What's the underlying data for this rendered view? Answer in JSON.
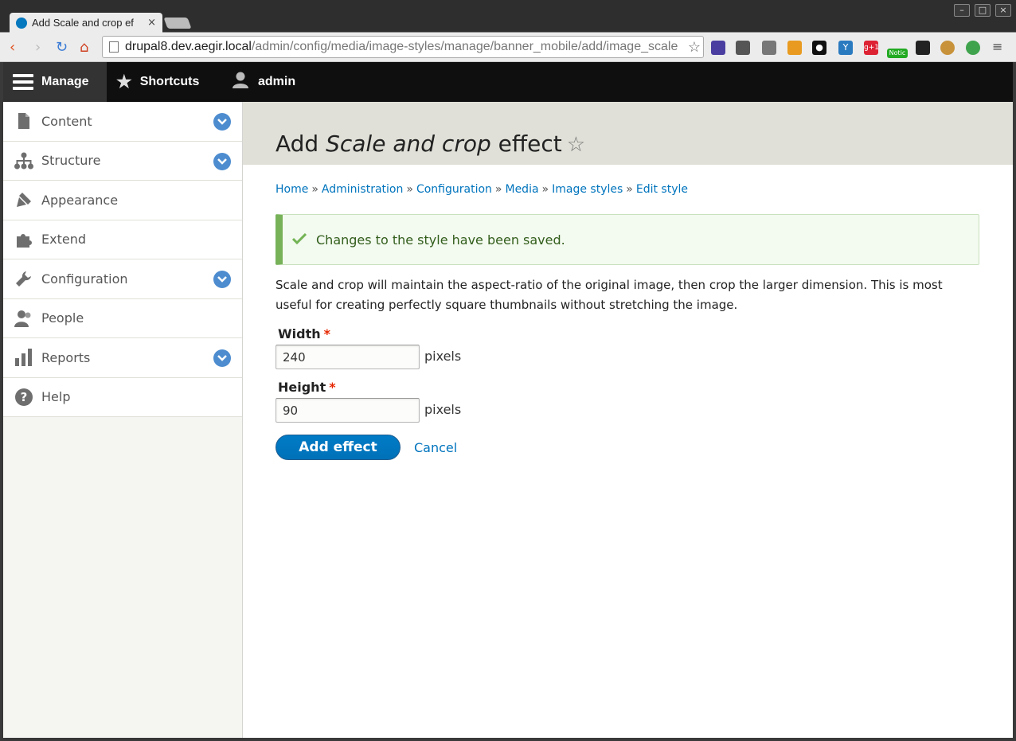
{
  "browser": {
    "tab_title": "Add Scale and crop ef",
    "url_host": "drupal8.dev.aegir.local",
    "url_path": "/admin/config/media/image-styles/manage/banner_mobile/add/image_scale",
    "badge_text": "Notic"
  },
  "toolbar": {
    "manage": "Manage",
    "shortcuts": "Shortcuts",
    "user": "admin"
  },
  "sidebar": {
    "items": [
      {
        "label": "Content",
        "icon": "file-icon",
        "expandable": true
      },
      {
        "label": "Structure",
        "icon": "sitemap-icon",
        "expandable": true
      },
      {
        "label": "Appearance",
        "icon": "paintbrush-icon",
        "expandable": false
      },
      {
        "label": "Extend",
        "icon": "puzzle-icon",
        "expandable": false
      },
      {
        "label": "Configuration",
        "icon": "wrench-icon",
        "expandable": true
      },
      {
        "label": "People",
        "icon": "people-icon",
        "expandable": false
      },
      {
        "label": "Reports",
        "icon": "bar-chart-icon",
        "expandable": true
      },
      {
        "label": "Help",
        "icon": "help-icon",
        "expandable": false
      }
    ]
  },
  "page": {
    "title_prefix": "Add ",
    "title_emphasis": "Scale and crop",
    "title_suffix": " effect"
  },
  "breadcrumb": {
    "separator": "»",
    "items": [
      "Home",
      "Administration",
      "Configuration",
      "Media",
      "Image styles",
      "Edit style"
    ]
  },
  "message": {
    "text": "Changes to the style have been saved."
  },
  "description": "Scale and crop will maintain the aspect-ratio of the original image, then crop the larger dimension. This is most useful for creating perfectly square thumbnails without stretching the image.",
  "form": {
    "width": {
      "label": "Width",
      "value": "240",
      "unit": "pixels",
      "required": "*"
    },
    "height": {
      "label": "Height",
      "value": "90",
      "unit": "pixels",
      "required": "*"
    },
    "submit_label": "Add effect",
    "cancel_label": "Cancel"
  },
  "colors": {
    "link": "#0074bd",
    "primary_button": "#0071b8",
    "success_border": "#77b259",
    "toggle": "#4d8ccf"
  }
}
